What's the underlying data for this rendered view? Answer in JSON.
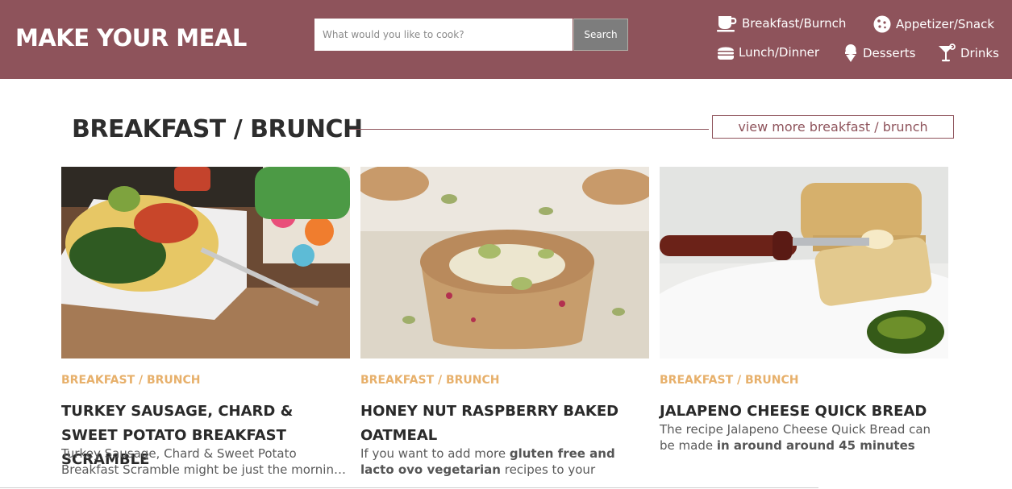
{
  "header": {
    "logo": "MAKE YOUR MEAL",
    "search": {
      "placeholder": "What would you like to cook?",
      "button_label": "Search"
    },
    "nav": [
      {
        "label": "Breakfast/Burnch",
        "icon": "coffee-cup-icon"
      },
      {
        "label": "Appetizer/Snack",
        "icon": "cookie-icon"
      },
      {
        "label": "Lunch/Dinner",
        "icon": "burger-icon"
      },
      {
        "label": "Desserts",
        "icon": "ice-cream-icon"
      },
      {
        "label": "Drinks",
        "icon": "cocktail-icon"
      }
    ]
  },
  "section": {
    "title": "BREAKFAST / BRUNCH",
    "view_more": "view more breakfast / brunch"
  },
  "cards": [
    {
      "category": "BREAKFAST / BRUNCH",
      "title": "TURKEY SAUSAGE, CHARD & SWEET POTATO BREAKFAST SCRAMBLE",
      "desc_start": "Turkey Sausage, Chard & Sweet Potato Breakfast Scramble might be just the morning meal you are searching for."
    },
    {
      "category": "BREAKFAST / BRUNCH",
      "title": "HONEY NUT RASPBERRY BAKED OATMEAL",
      "desc_start": "If you want to add more ",
      "desc_bold1": "gluten free and lacto ovo vegetarian",
      "desc_mid": " recipes to your"
    },
    {
      "category": "BREAKFAST / BRUNCH",
      "title": "JALAPENO CHEESE QUICK BREAD",
      "desc_start": "The recipe Jalapeno Cheese Quick Bread can be made ",
      "desc_bold1": "in around around 45 minutes"
    }
  ],
  "colors": {
    "header_bg": "#8e535b",
    "accent": "#8e535b",
    "category": "#e7b06b",
    "search_button": "#7d7d7d"
  }
}
